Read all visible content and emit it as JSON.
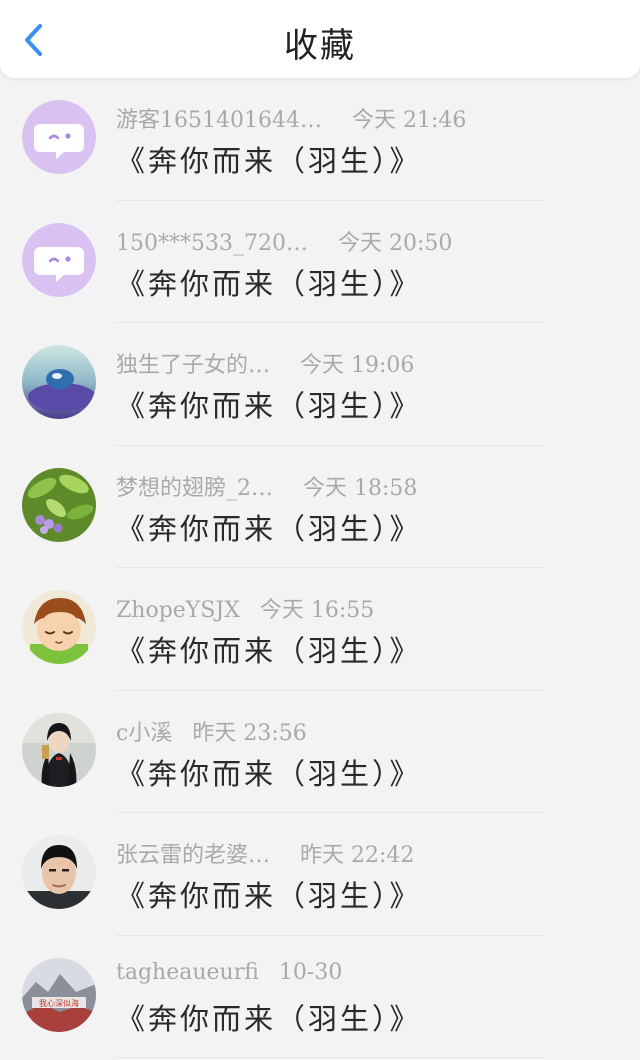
{
  "header": {
    "title": "收藏",
    "back_icon": "chevron-left-icon",
    "accent": "#3b8ff3"
  },
  "favorites": [
    {
      "user": "游客1651401644…",
      "time": "今天 21:46",
      "song": "《奔你而来（羽生）》",
      "avatar": "default-chat-avatar-icon"
    },
    {
      "user": "150***533_720…",
      "time": "今天 20:50",
      "song": "《奔你而来（羽生）》",
      "avatar": "default-chat-avatar-icon"
    },
    {
      "user": "独生了子女的…",
      "time": "今天 19:06",
      "song": "《奔你而来（羽生）》",
      "avatar": "water-drop-avatar"
    },
    {
      "user": "梦想的翅膀_2…",
      "time": "今天 18:58",
      "song": "《奔你而来（羽生）》",
      "avatar": "purple-flower-avatar"
    },
    {
      "user": "ZhopeYSJX",
      "time": "今天 16:55",
      "song": "《奔你而来（羽生）》",
      "avatar": "cartoon-boy-avatar"
    },
    {
      "user": "c小溪",
      "time": "昨天 23:56",
      "song": "《奔你而来（羽生）》",
      "avatar": "costume-character-avatar"
    },
    {
      "user": "张云雷的老婆…",
      "time": "昨天 22:42",
      "song": "《奔你而来（羽生）》",
      "avatar": "man-portrait-avatar"
    },
    {
      "user": "tagheaueurfi",
      "time": "10-30",
      "song": "《奔你而来（羽生）》",
      "avatar": "landscape-text-avatar",
      "avatar_text": "我心深似海"
    }
  ]
}
